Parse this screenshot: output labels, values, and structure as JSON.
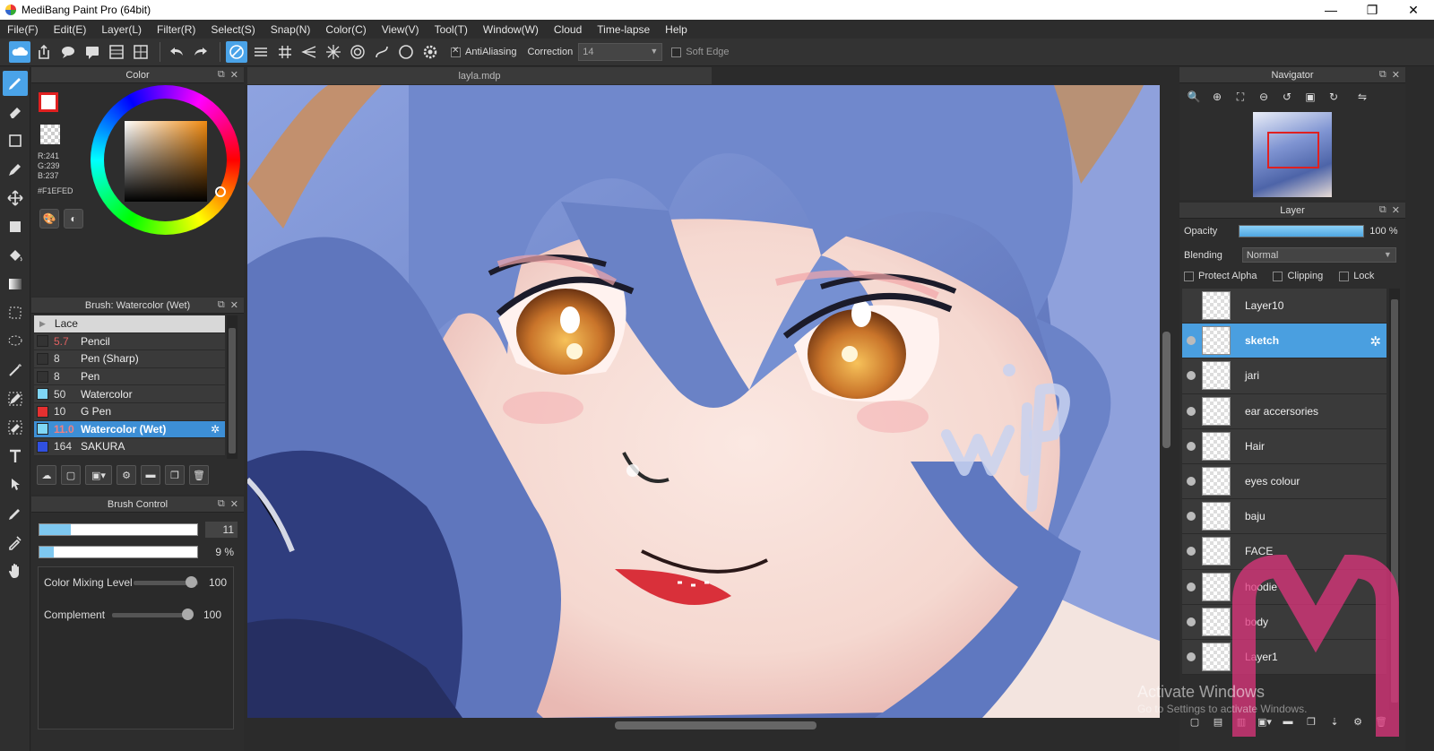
{
  "window": {
    "title": "MediBang Paint Pro (64bit)",
    "controls": [
      "—",
      "❐",
      "✕"
    ]
  },
  "menu": [
    "File(F)",
    "Edit(E)",
    "Layer(L)",
    "Filter(R)",
    "Select(S)",
    "Snap(N)",
    "Color(C)",
    "View(V)",
    "Tool(T)",
    "Window(W)",
    "Cloud",
    "Time-lapse",
    "Help"
  ],
  "toolbar": {
    "antialiasing_label": "AntiAliasing",
    "correction_label": "Correction",
    "correction_value": "14",
    "soft_edge_label": "Soft Edge"
  },
  "color_panel": {
    "title": "Color",
    "r": "R:241",
    "g": "G:239",
    "b": "B:237",
    "hex": "#F1EFED",
    "primary_color": "#e02020"
  },
  "brush_panel": {
    "title": "Brush: Watercolor (Wet)",
    "group": "Lace",
    "items": [
      {
        "size": "5.7",
        "name": "Pencil",
        "color": "#333333",
        "size_color": "#e06060"
      },
      {
        "size": "8",
        "name": "Pen (Sharp)",
        "color": "#333333",
        "size_color": "#dddddd"
      },
      {
        "size": "8",
        "name": "Pen",
        "color": "#333333",
        "size_color": "#dddddd"
      },
      {
        "size": "50",
        "name": "Watercolor",
        "color": "#7fd6f5",
        "size_color": "#dddddd"
      },
      {
        "size": "10",
        "name": "G Pen",
        "color": "#e53030",
        "size_color": "#dddddd"
      },
      {
        "size": "11.0",
        "name": "Watercolor (Wet)",
        "color": "#7fd6f5",
        "size_color": "#f08080"
      },
      {
        "size": "164",
        "name": "SAKURA",
        "color": "#3050e0",
        "size_color": "#dddddd"
      }
    ]
  },
  "brush_control": {
    "title": "Brush Control",
    "size_value": "11",
    "size_fraction": 0.2,
    "opacity_value": "9 %",
    "opacity_fraction": 0.09,
    "color_mixing_label": "Color Mixing Level",
    "color_mixing_value": "100",
    "complement_label": "Complement",
    "complement_value": "100"
  },
  "canvas": {
    "filename": "layla.mdp",
    "wip_text": "wip"
  },
  "navigator": {
    "title": "Navigator"
  },
  "layer_panel": {
    "title": "Layer",
    "opacity_label": "Opacity",
    "opacity_value": "100 %",
    "blending_label": "Blending",
    "blending_value": "Normal",
    "protect_alpha": "Protect Alpha",
    "clipping": "Clipping",
    "lock": "Lock",
    "layers": [
      {
        "name": "Layer10",
        "visible": false,
        "selected": false
      },
      {
        "name": "sketch",
        "visible": true,
        "selected": true
      },
      {
        "name": "jari",
        "visible": true,
        "selected": false
      },
      {
        "name": "ear accersories",
        "visible": true,
        "selected": false
      },
      {
        "name": "Hair",
        "visible": true,
        "selected": false
      },
      {
        "name": "eyes colour",
        "visible": true,
        "selected": false
      },
      {
        "name": "baju",
        "visible": true,
        "selected": false
      },
      {
        "name": "FACE",
        "visible": true,
        "selected": false
      },
      {
        "name": "hoodie",
        "visible": true,
        "selected": false
      },
      {
        "name": "body",
        "visible": true,
        "selected": false
      },
      {
        "name": "Layer1",
        "visible": true,
        "selected": false
      }
    ]
  },
  "os_watermark": {
    "line1": "Activate Windows",
    "line2": "Go to Settings to activate Windows."
  }
}
